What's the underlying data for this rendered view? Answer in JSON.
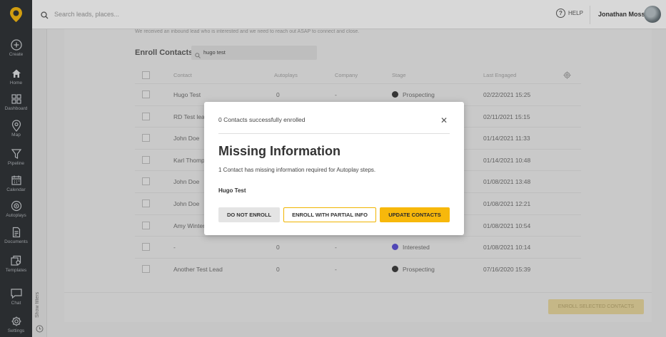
{
  "topbar": {
    "search_placeholder": "Search leads, places...",
    "help_label": "HELP",
    "user_name": "Jonathan Moss"
  },
  "sidebar": {
    "items": [
      {
        "label": "Create",
        "icon": "plus-circle-icon"
      },
      {
        "label": "Home",
        "icon": "home-icon"
      },
      {
        "label": "Dashboard",
        "icon": "dashboard-icon"
      },
      {
        "label": "Map",
        "icon": "map-pin-icon"
      },
      {
        "label": "Pipeline",
        "icon": "funnel-icon"
      },
      {
        "label": "Calendar",
        "icon": "calendar-icon"
      },
      {
        "label": "Autoplays",
        "icon": "autoplay-icon"
      },
      {
        "label": "Documents",
        "icon": "document-icon"
      },
      {
        "label": "Templates",
        "icon": "templates-icon"
      },
      {
        "label": "Chat",
        "icon": "chat-icon"
      },
      {
        "label": "Settings",
        "icon": "gear-icon"
      }
    ],
    "show_filters": "Show filters"
  },
  "main": {
    "truncated_text": "We received an inbound lead who is interested and we need to reach out ASAP to connect and close.",
    "enroll_title": "Enroll Contacts",
    "search_value": "hugo test",
    "columns": [
      "Contact",
      "Autoplays",
      "Company",
      "Stage",
      "Last Engaged"
    ],
    "rows": [
      {
        "contact": "Hugo Test",
        "autoplays": "0",
        "company": "-",
        "stage": "Prospecting",
        "stage_color": "#3a3a3a",
        "last": "02/22/2021 15:25"
      },
      {
        "contact": "RD Test lead",
        "autoplays": "",
        "company": "",
        "stage": "",
        "stage_color": "",
        "last": "02/11/2021 15:15"
      },
      {
        "contact": "John Doe",
        "autoplays": "",
        "company": "",
        "stage": "",
        "stage_color": "",
        "last": "01/14/2021 11:33"
      },
      {
        "contact": "Karl Thompson",
        "autoplays": "",
        "company": "",
        "stage": "",
        "stage_color": "",
        "last": "01/14/2021 10:48"
      },
      {
        "contact": "John Doe",
        "autoplays": "",
        "company": "",
        "stage": "",
        "stage_color": "",
        "last": "01/08/2021 13:48"
      },
      {
        "contact": "John Doe",
        "autoplays": "",
        "company": "",
        "stage": "",
        "stage_color": "",
        "last": "01/08/2021 12:21"
      },
      {
        "contact": "Amy Winters",
        "autoplays": "",
        "company": "",
        "stage": "",
        "stage_color": "",
        "last": "01/08/2021 10:54"
      },
      {
        "contact": "-",
        "autoplays": "0",
        "company": "-",
        "stage": "Interested",
        "stage_color": "#5b4fd6",
        "last": "01/08/2021 10:14"
      },
      {
        "contact": "Another Test Lead",
        "autoplays": "0",
        "company": "-",
        "stage": "Prospecting",
        "stage_color": "#3a3a3a",
        "last": "07/16/2020 15:39"
      }
    ],
    "enroll_selected_label": "ENROLL SELECTED CONTACTS"
  },
  "modal": {
    "status": "0 Contacts successfully enrolled",
    "title": "Missing Information",
    "description": "1 Contact has missing information required for Autoplay steps.",
    "contact_name": "Hugo Test",
    "btn_do_not_enroll": "DO NOT ENROLL",
    "btn_partial": "ENROLL WITH PARTIAL INFO",
    "btn_update": "UPDATE CONTACTS"
  },
  "colors": {
    "accent": "#f7b80b",
    "sidebar_bg": "#2b2f33",
    "stage_prospecting": "#3a3a3a",
    "stage_interested": "#5b4fd6"
  }
}
